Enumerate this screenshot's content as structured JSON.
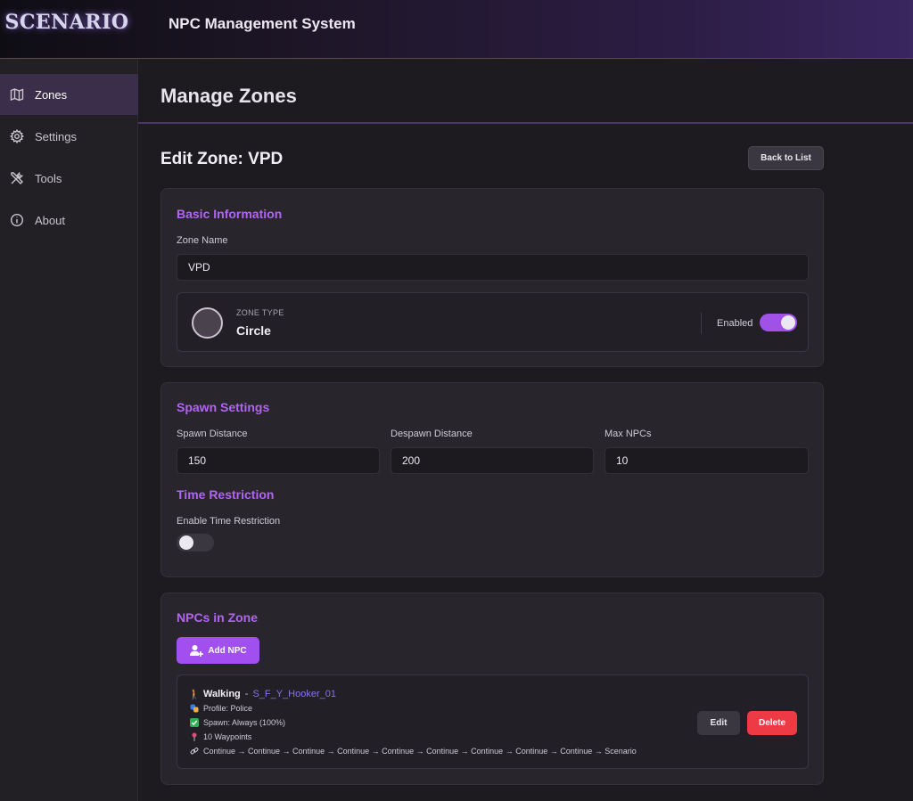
{
  "header": {
    "logo_text": "SCENARIO",
    "title": "NPC Management System"
  },
  "sidebar": {
    "items": [
      {
        "label": "Zones",
        "icon": "map-icon",
        "active": true
      },
      {
        "label": "Settings",
        "icon": "gear-icon",
        "active": false
      },
      {
        "label": "Tools",
        "icon": "tools-icon",
        "active": false
      },
      {
        "label": "About",
        "icon": "info-icon",
        "active": false
      }
    ]
  },
  "main": {
    "page_title": "Manage Zones",
    "edit_title": "Edit Zone: VPD",
    "back_button": "Back to List"
  },
  "basic_info": {
    "title": "Basic Information",
    "zone_name_label": "Zone Name",
    "zone_name_value": "VPD",
    "zone_type_label": "ZONE TYPE",
    "zone_type_value": "Circle",
    "enabled_label": "Enabled",
    "enabled": true
  },
  "spawn_settings": {
    "title": "Spawn Settings",
    "spawn_distance_label": "Spawn Distance",
    "spawn_distance_value": "150",
    "despawn_distance_label": "Despawn Distance",
    "despawn_distance_value": "200",
    "max_npcs_label": "Max NPCs",
    "max_npcs_value": "10"
  },
  "time_restriction": {
    "title": "Time Restriction",
    "enable_label": "Enable Time Restriction",
    "enabled": false
  },
  "npcs": {
    "title": "NPCs in Zone",
    "add_button": "Add NPC",
    "items": [
      {
        "type": "Walking",
        "separator": " - ",
        "model": "S_F_Y_Hooker_01",
        "profile": "Profile: Police",
        "spawn": "Spawn: Always (100%)",
        "waypoints": "10 Waypoints",
        "chain": "Continue → Continue → Continue → Continue → Continue → Continue → Continue → Continue → Continue → Scenario",
        "edit_label": "Edit",
        "delete_label": "Delete"
      }
    ]
  },
  "colors": {
    "accent": "#a24ff0",
    "section_title": "#b165f2",
    "danger": "#ee3a44",
    "link": "#8a74e8"
  }
}
